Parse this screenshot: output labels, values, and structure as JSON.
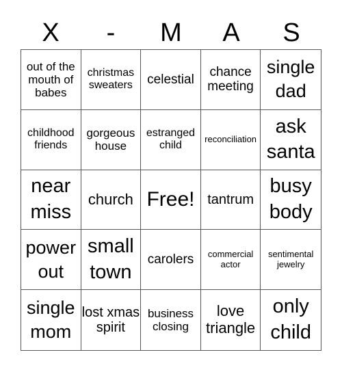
{
  "header": {
    "letters": [
      "X",
      "-",
      "M",
      "A",
      "S"
    ]
  },
  "cells": [
    "out of the mouth of babes",
    "christmas sweaters",
    "celestial",
    "chance meeting",
    "single dad",
    "childhood friends",
    "gorgeous house",
    "estranged child",
    "reconciliation",
    "ask santa",
    "near miss",
    "church",
    "Free!",
    "tantrum",
    "busy body",
    "power out",
    "small town",
    "carolers",
    "commercial actor",
    "sentimental jewelry",
    "single mom",
    "lost xmas spirit",
    "business closing",
    "love triangle",
    "only child"
  ]
}
